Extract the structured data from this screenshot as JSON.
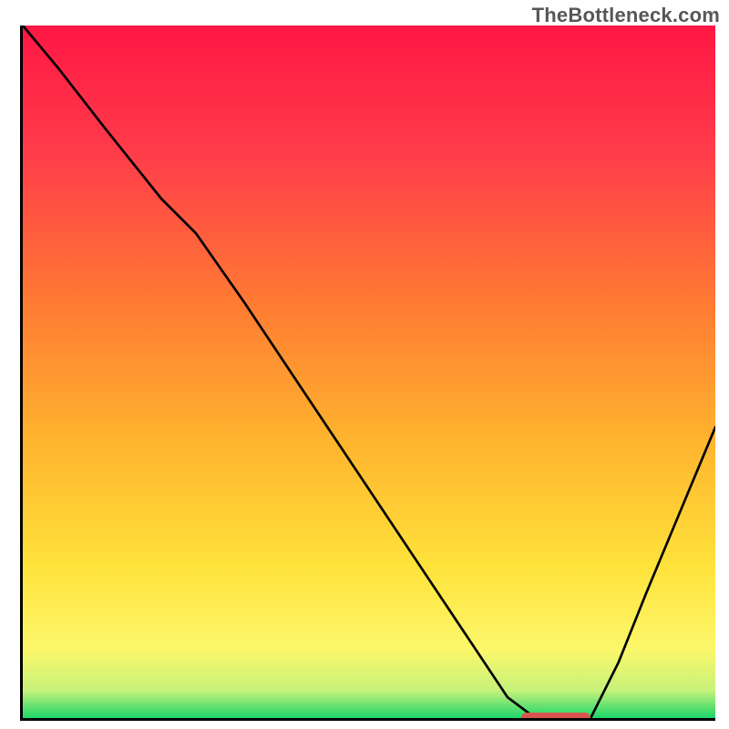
{
  "watermark": "TheBottleneck.com",
  "colors": {
    "axis": "#000000",
    "curve": "#000000",
    "marker": "#d9544f",
    "gradient_stops": [
      {
        "offset": 0,
        "color": "#ff1744"
      },
      {
        "offset": 18,
        "color": "#ff3b4a"
      },
      {
        "offset": 40,
        "color": "#ff7a33"
      },
      {
        "offset": 60,
        "color": "#ffb42e"
      },
      {
        "offset": 78,
        "color": "#ffe23a"
      },
      {
        "offset": 90,
        "color": "#fcf76a"
      },
      {
        "offset": 96,
        "color": "#c7f27a"
      },
      {
        "offset": 100,
        "color": "#1bd66a"
      }
    ]
  },
  "chart_data": {
    "type": "line",
    "title": "",
    "xlabel": "",
    "ylabel": "",
    "xlim": [
      0,
      100
    ],
    "ylim": [
      0,
      100
    ],
    "x": [
      0,
      5,
      12,
      20,
      25,
      32,
      40,
      48,
      56,
      64,
      70,
      74,
      78,
      82,
      86,
      90,
      95,
      100
    ],
    "bottleneck_pct": [
      100,
      94,
      85,
      75,
      70,
      60,
      48,
      36,
      24,
      12,
      3,
      0,
      0,
      0,
      8,
      18,
      30,
      42
    ],
    "optimal_range_x": [
      72,
      82
    ],
    "note": "Curve y-values are bottleneck percentage (100 = worst / top of plot, 0 = best / bottom). Optimal marker sits on x-axis spanning optimal_range_x."
  }
}
